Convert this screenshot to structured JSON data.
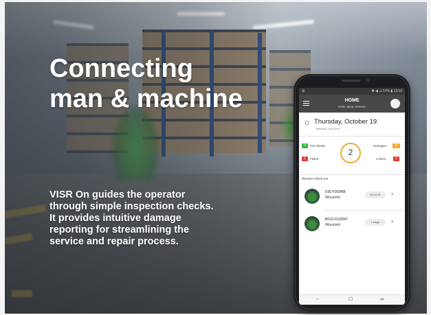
{
  "slide": {
    "headline_line1": "Connecting",
    "headline_line2": "man & machine",
    "body": "VISR On guides the operator through simple inspection checks. It provides intuitive damage reporting for streamlining the service and repair process."
  },
  "phone": {
    "statusbar": {
      "left": "⚙",
      "right": "✱ ◀ ⊿ 57% ▮ 13:19"
    },
    "appbar": {
      "title": "HOME",
      "subtitle": "Hello Jason Zimmer",
      "menu_icon": "hamburger-icon"
    },
    "date": {
      "weather_icon": "sun-cloud-icon",
      "text": "Thursday, October 19",
      "sub": "Jettering Clear-tech"
    },
    "stats": {
      "pre_checks": {
        "count": "3",
        "label": "Pre-checks",
        "color": "#35b34a"
      },
      "failed": {
        "count": "2",
        "label": "Failed",
        "color": "#e53935"
      },
      "damages": {
        "count": "11",
        "label": "Damages",
        "color": "#f0a92b"
      },
      "critical": {
        "count": "2",
        "label": "Critical",
        "color": "#e53935"
      },
      "total": "2",
      "ring_color": "#f0a92b"
    },
    "recent_label": "Recent check-ins",
    "recent": [
      {
        "title": "D30 FD50NB",
        "sub": "Mitsubishi",
        "chip": "09:10:37"
      },
      {
        "title": "BD10 FG25NT",
        "sub": "Mitsubishi",
        "chip": "1 stage"
      }
    ],
    "navbar": {
      "back": "←",
      "home": "☐",
      "recent": "⇌"
    }
  }
}
